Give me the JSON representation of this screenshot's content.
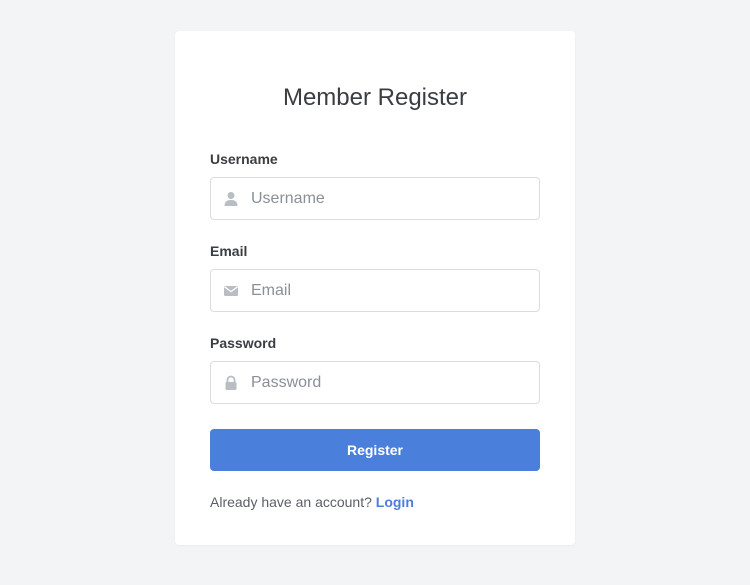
{
  "form": {
    "title": "Member Register",
    "username": {
      "label": "Username",
      "placeholder": "Username",
      "icon": "user-icon"
    },
    "email": {
      "label": "Email",
      "placeholder": "Email",
      "icon": "envelope-icon"
    },
    "password": {
      "label": "Password",
      "placeholder": "Password",
      "icon": "lock-icon"
    },
    "submit_label": "Register",
    "footer_text": "Already have an account?",
    "login_link": "Login"
  },
  "colors": {
    "background": "#f3f4f6",
    "card": "#ffffff",
    "primary": "#4a7fdc",
    "icon": "#b9bdc4"
  }
}
